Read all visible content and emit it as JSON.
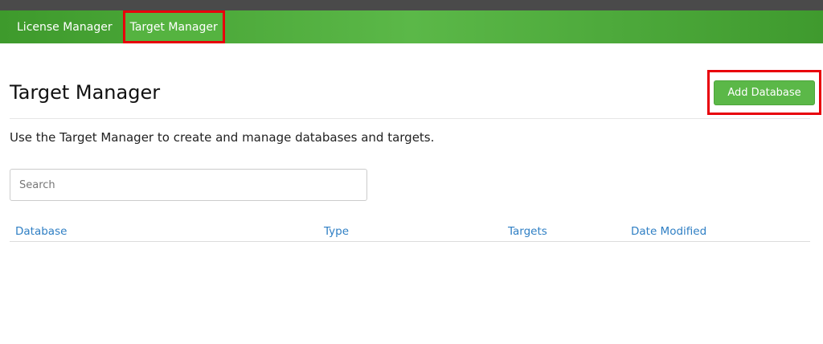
{
  "nav": {
    "items": [
      {
        "label": "License Manager"
      },
      {
        "label": "Target Manager"
      }
    ]
  },
  "page": {
    "title": "Target Manager",
    "description": "Use the Target Manager to create and manage databases and targets.",
    "add_button_label": "Add Database"
  },
  "search": {
    "placeholder": "Search",
    "value": ""
  },
  "table": {
    "columns": [
      "Database",
      "Type",
      "Targets",
      "Date Modified"
    ]
  },
  "colors": {
    "accent_green": "#5bb848",
    "link_blue": "#2f7fc4",
    "highlight_red": "#e8000b"
  }
}
